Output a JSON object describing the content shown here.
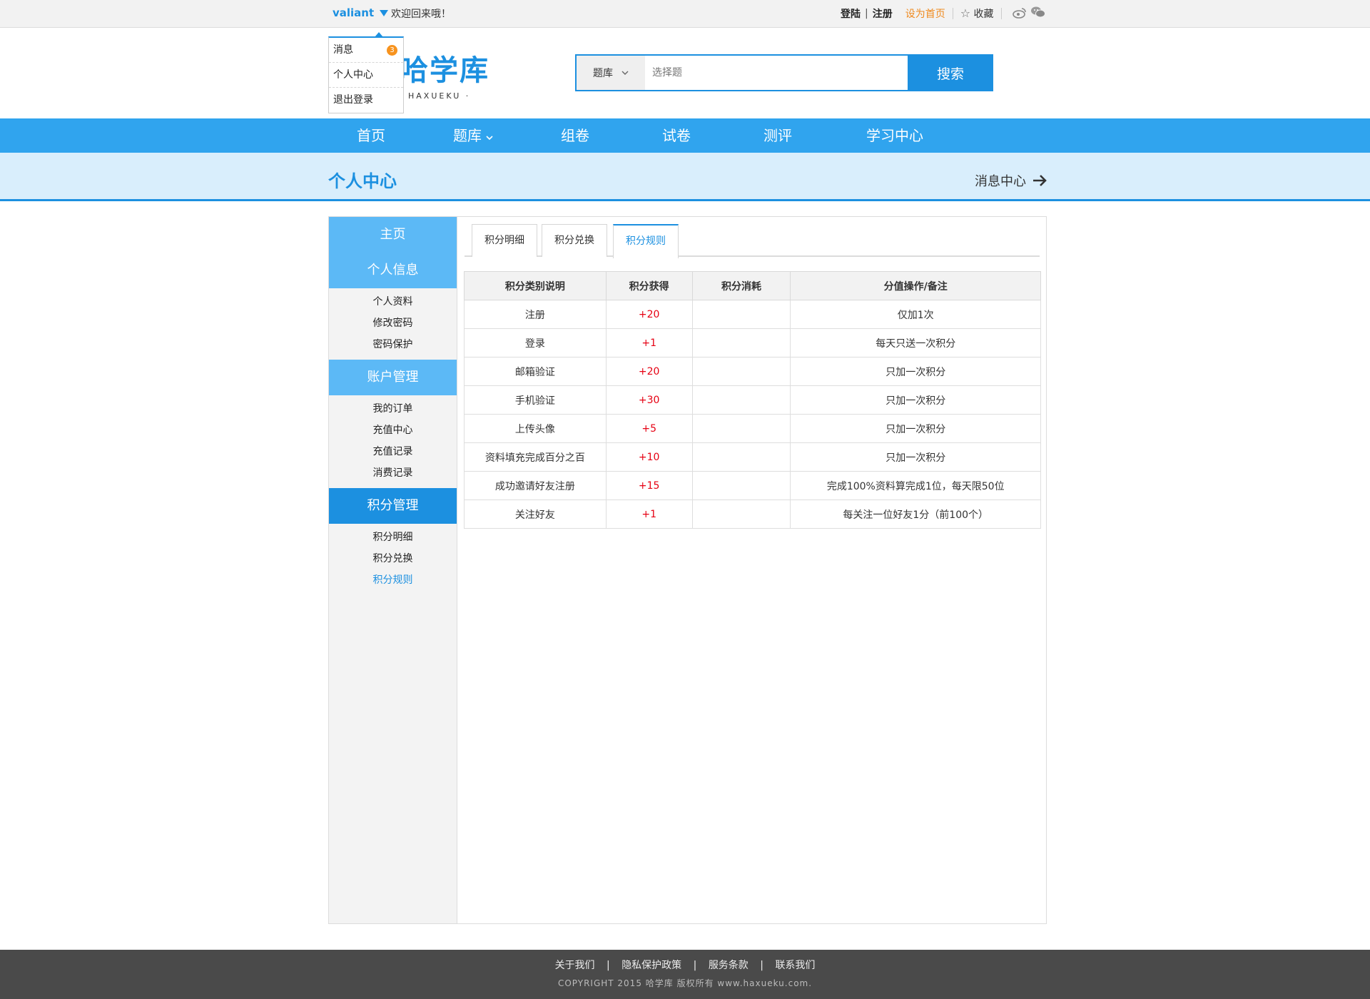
{
  "topbar": {
    "username": "valiant",
    "welcome": "欢迎回来哦！",
    "login": "登陆",
    "separator": "|",
    "register": "注册",
    "set_home": "设为首页",
    "favorite": "收藏"
  },
  "dropdown": {
    "items": [
      {
        "label": "消息",
        "badge": "3"
      },
      {
        "label": "个人中心"
      },
      {
        "label": "退出登录"
      }
    ]
  },
  "header": {
    "logo": "哈学库",
    "logo_sub": "HAXUEKU ·",
    "search_type": "题库",
    "search_placeholder": "选择题",
    "search_button": "搜索"
  },
  "nav": [
    "首页",
    "题库",
    "组卷",
    "试卷",
    "测评",
    "学习中心"
  ],
  "band": {
    "title": "个人中心",
    "link": "消息中心"
  },
  "sidebar": {
    "home": "主页",
    "groups": [
      {
        "title": "个人信息",
        "items": [
          "个人资料",
          "修改密码",
          "密码保护"
        ]
      },
      {
        "title": "账户管理",
        "items": [
          "我的订单",
          "充值中心",
          "充值记录",
          "消费记录"
        ]
      },
      {
        "title": "积分管理",
        "items": [
          "积分明细",
          "积分兑换",
          "积分规则"
        ]
      }
    ]
  },
  "tabs": [
    "积分明细",
    "积分兑换",
    "积分规则"
  ],
  "table": {
    "headers": [
      "积分类别说明",
      "积分获得",
      "积分消耗",
      "分值操作/备注"
    ],
    "rows": [
      [
        "注册",
        "+20",
        "",
        "仅加1次"
      ],
      [
        "登录",
        "+1",
        "",
        "每天只送一次积分"
      ],
      [
        "邮箱验证",
        "+20",
        "",
        "只加一次积分"
      ],
      [
        "手机验证",
        "+30",
        "",
        "只加一次积分"
      ],
      [
        "上传头像",
        "+5",
        "",
        "只加一次积分"
      ],
      [
        "资料填充完成百分之百",
        "+10",
        "",
        "只加一次积分"
      ],
      [
        "成功邀请好友注册",
        "+15",
        "",
        "完成100%资料算完成1位，每天限50位"
      ],
      [
        "关注好友",
        "+1",
        "",
        "每关注一位好友1分（前100个）"
      ]
    ]
  },
  "footer": {
    "links": [
      "关于我们",
      "隐私保护政策",
      "服务条款",
      "联系我们"
    ],
    "divider": "|",
    "copyright": "COPYRIGHT 2015   哈学库   版权所有    www.haxueku.com."
  },
  "colors": {
    "accent": "#1c90e0",
    "nav": "#30a4ee",
    "band": "#d9eefc",
    "orange": "#ef8a1f",
    "red": "#e60012",
    "footer": "#4a4a4a"
  }
}
